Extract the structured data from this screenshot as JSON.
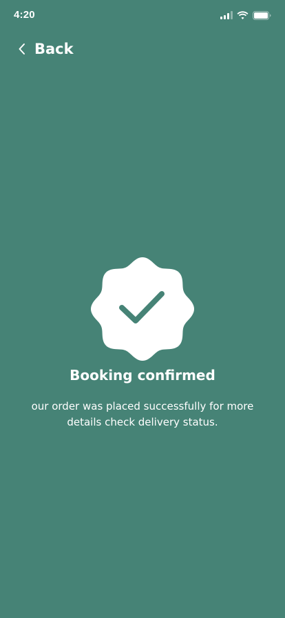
{
  "status_bar": {
    "time": "4:20",
    "icons": [
      "cellular-signal-icon",
      "wifi-icon",
      "battery-icon"
    ]
  },
  "header": {
    "back_icon": "chevron-left-icon",
    "back_label": "Back"
  },
  "confirmation": {
    "badge_icon": "checkmark-badge-icon",
    "title": "Booking confirmed",
    "message": "our order was placed successfully for more details check delivery status."
  },
  "colors": {
    "background": "#468376",
    "badge": "#ffffff",
    "check": "#468376",
    "text": "#ffffff"
  }
}
